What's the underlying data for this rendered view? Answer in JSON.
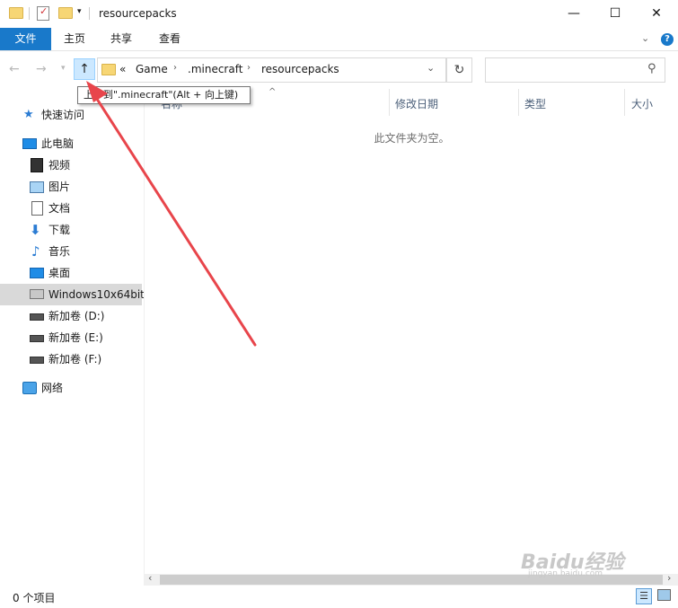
{
  "window": {
    "title": "resourcepacks",
    "minimize_icon": "minimize-icon",
    "maximize_icon": "maximize-icon",
    "close_icon": "close-icon"
  },
  "ribbon": {
    "tabs": [
      "文件",
      "主页",
      "共享",
      "查看"
    ],
    "accent": "#1979ca"
  },
  "nav": {
    "breadcrumb_prefix": "«",
    "breadcrumb": [
      "Game",
      ".minecraft",
      "resourcepacks"
    ],
    "search_placeholder": ""
  },
  "tooltip": {
    "text": "上移到\".minecraft\"(Alt + 向上键)"
  },
  "sidebar": {
    "items": [
      {
        "label": "快速访问",
        "icon": "star-icon"
      },
      {
        "label": "此电脑",
        "icon": "computer-icon"
      },
      {
        "label": "视频",
        "icon": "video-icon"
      },
      {
        "label": "图片",
        "icon": "picture-icon"
      },
      {
        "label": "文档",
        "icon": "document-icon"
      },
      {
        "label": "下载",
        "icon": "download-icon"
      },
      {
        "label": "音乐",
        "icon": "music-icon"
      },
      {
        "label": "桌面",
        "icon": "desktop-icon"
      },
      {
        "label": "Windows10x64bit",
        "icon": "system-drive-icon"
      },
      {
        "label": "新加卷 (D:)",
        "icon": "drive-icon"
      },
      {
        "label": "新加卷 (E:)",
        "icon": "drive-icon"
      },
      {
        "label": "新加卷 (F:)",
        "icon": "drive-icon"
      },
      {
        "label": "网络",
        "icon": "network-icon"
      }
    ]
  },
  "columns": [
    "名称",
    "修改日期",
    "类型",
    "大小"
  ],
  "empty_message": "此文件夹为空。",
  "status": {
    "item_count": "0 个项目"
  },
  "watermark": {
    "brand": "Baidu经验",
    "url": "jingyan.baidu.com"
  },
  "annotation_color": "#e8454b"
}
